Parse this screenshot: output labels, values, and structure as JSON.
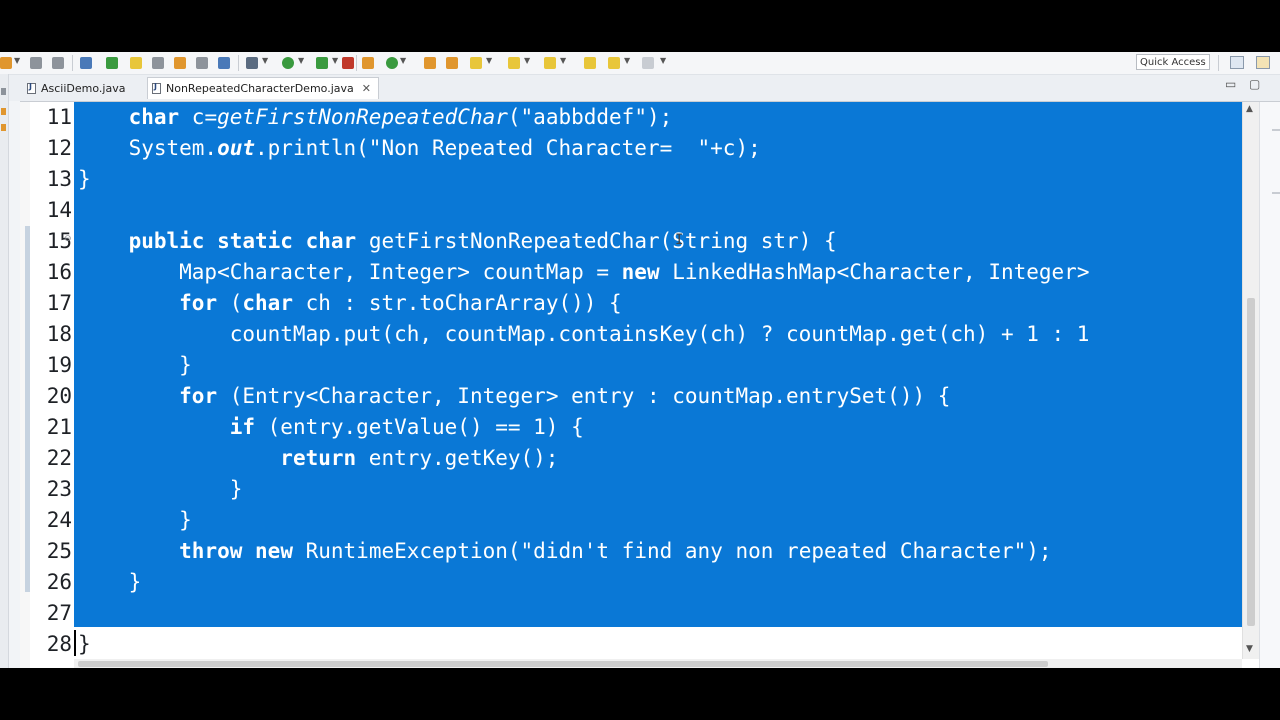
{
  "toolbar": {
    "quick_access_label": "Quick Access",
    "icons": [
      "new-icon",
      "save-icon",
      "save-all-icon",
      "search-icon",
      "debug-icon",
      "marker-icon",
      "run-icon",
      "run-ext-icon",
      "coverage-icon",
      "package-icon",
      "refresh-icon",
      "open-type-icon",
      "open-folder-icon",
      "search-file-icon",
      "pin-icon",
      "next-icon",
      "prev-icon",
      "back-icon",
      "forward-icon"
    ],
    "colors": {
      "icon_green": "#3a9a3f",
      "icon_orange": "#e0962e",
      "icon_blue": "#4a79b8",
      "icon_gray": "#8d939b"
    }
  },
  "tabs": [
    {
      "label": "AsciiDemo.java",
      "active": false
    },
    {
      "label": "NonRepeatedCharacterDemo.java",
      "active": true
    }
  ],
  "tab_controls": {
    "minimize": "▭",
    "maximize": "▢"
  },
  "editor": {
    "selection_color": "#0a78d6",
    "line_numbers": [
      "11",
      "12",
      "13",
      "14",
      "15",
      "16",
      "17",
      "18",
      "19",
      "20",
      "21",
      "22",
      "23",
      "24",
      "25",
      "26",
      "27",
      "28"
    ],
    "lines": [
      {
        "segments": [
          [
            "    ",
            ""
          ],
          [
            "char",
            "kw"
          ],
          [
            " c=",
            ""
          ],
          [
            "getFirstNonRepeatedChar",
            "it"
          ],
          [
            "(\"aabbddef\");",
            ""
          ]
        ]
      },
      {
        "segments": [
          [
            "    System.",
            ""
          ],
          [
            "out",
            "bi"
          ],
          [
            ".println(\"Non Repeated Character=  \"+c);",
            ""
          ]
        ]
      },
      {
        "segments": [
          [
            "}",
            ""
          ]
        ]
      },
      {
        "segments": []
      },
      {
        "segments": [
          [
            "    ",
            ""
          ],
          [
            "public",
            "kw"
          ],
          [
            " ",
            ""
          ],
          [
            "static",
            "kw"
          ],
          [
            " ",
            ""
          ],
          [
            "char",
            "kw"
          ],
          [
            " getFirstNonRepeatedChar(String str) {",
            ""
          ]
        ]
      },
      {
        "segments": [
          [
            "        Map<Character, Integer> countMap = ",
            ""
          ],
          [
            "new",
            "kw"
          ],
          [
            " LinkedHashMap<Character, Integer>",
            ""
          ]
        ]
      },
      {
        "segments": [
          [
            "        ",
            ""
          ],
          [
            "for",
            "kw"
          ],
          [
            " (",
            ""
          ],
          [
            "char",
            "kw"
          ],
          [
            " ch : str.toCharArray()) {",
            ""
          ]
        ]
      },
      {
        "segments": [
          [
            "            countMap.put(ch, countMap.containsKey(ch) ? countMap.get(ch) + 1 : 1",
            ""
          ]
        ]
      },
      {
        "segments": [
          [
            "        }",
            ""
          ]
        ]
      },
      {
        "segments": [
          [
            "        ",
            ""
          ],
          [
            "for",
            "kw"
          ],
          [
            " (Entry<Character, Integer> entry : countMap.entrySet()) {",
            ""
          ]
        ]
      },
      {
        "segments": [
          [
            "            ",
            ""
          ],
          [
            "if",
            "kw"
          ],
          [
            " (entry.getValue() == 1) {",
            ""
          ]
        ]
      },
      {
        "segments": [
          [
            "                ",
            ""
          ],
          [
            "return",
            "kw"
          ],
          [
            " entry.getKey();",
            ""
          ]
        ]
      },
      {
        "segments": [
          [
            "            }",
            ""
          ]
        ]
      },
      {
        "segments": [
          [
            "        }",
            ""
          ]
        ]
      },
      {
        "segments": [
          [
            "        ",
            ""
          ],
          [
            "throw",
            "kw"
          ],
          [
            " ",
            ""
          ],
          [
            "new",
            "kw"
          ],
          [
            " RuntimeException(\"didn't find any non repeated Character\");",
            ""
          ]
        ]
      },
      {
        "segments": [
          [
            "    }",
            ""
          ]
        ]
      },
      {
        "segments": []
      },
      {
        "segments": [
          [
            "}",
            ""
          ]
        ]
      }
    ],
    "selected_line_count": 17
  }
}
